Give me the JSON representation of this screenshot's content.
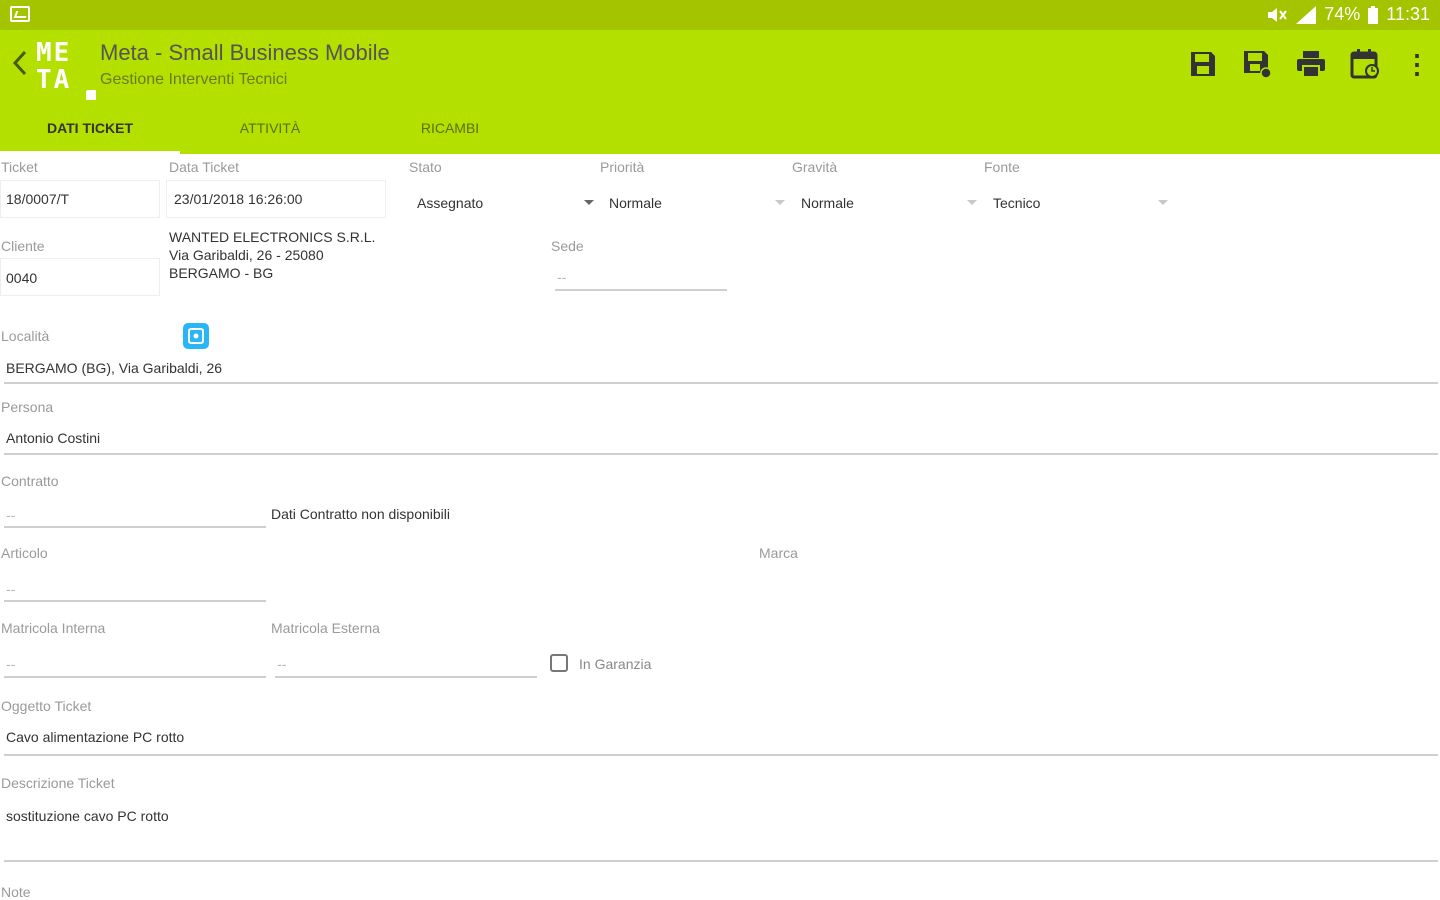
{
  "status_bar": {
    "battery": "74%",
    "time": "11:31"
  },
  "app": {
    "title": "Meta - Small Business Mobile",
    "subtitle": "Gestione Interventi Tecnici",
    "logo_top": "ME",
    "logo_bottom": "TA"
  },
  "toolbar": {
    "icons": [
      "save-icon",
      "save-as-icon",
      "print-icon",
      "calendar-icon",
      "more-icon"
    ],
    "more_label": "⋮"
  },
  "tabs": [
    {
      "label": "DATI TICKET"
    },
    {
      "label": "ATTIVITÀ"
    },
    {
      "label": "RICAMBI"
    }
  ],
  "form": {
    "ticket": {
      "label": "Ticket",
      "value": "18/0007/T"
    },
    "data_ticket": {
      "label": "Data Ticket",
      "value": "23/01/2018 16:26:00"
    },
    "stato": {
      "label": "Stato",
      "value": "Assegnato"
    },
    "priorita": {
      "label": "Priorità",
      "value": "Normale"
    },
    "gravita": {
      "label": "Gravità",
      "value": "Normale"
    },
    "fonte": {
      "label": "Fonte",
      "value": "Tecnico"
    },
    "cliente": {
      "label": "Cliente",
      "value": "0040",
      "name": "WANTED ELECTRONICS S.R.L.",
      "address1": "Via Garibaldi, 26 - 25080",
      "address2": "BERGAMO - BG"
    },
    "sede": {
      "label": "Sede",
      "placeholder": "--"
    },
    "localita": {
      "label": "Località",
      "value": "BERGAMO (BG), Via Garibaldi, 26"
    },
    "persona": {
      "label": "Persona",
      "value": "Antonio Costini"
    },
    "contratto": {
      "label": "Contratto",
      "placeholder": "--",
      "info": "Dati Contratto non disponibili"
    },
    "articolo": {
      "label": "Articolo",
      "placeholder": "--"
    },
    "marca": {
      "label": "Marca"
    },
    "matricola_interna": {
      "label": "Matricola Interna",
      "placeholder": "--"
    },
    "matricola_esterna": {
      "label": "Matricola Esterna",
      "placeholder": "--"
    },
    "in_garanzia": {
      "label": "In Garanzia",
      "checked": false
    },
    "oggetto": {
      "label": "Oggetto Ticket",
      "value": "Cavo alimentazione PC rotto"
    },
    "descrizione": {
      "label": "Descrizione Ticket",
      "value": "sostituzione cavo PC rotto"
    },
    "note": {
      "label": "Note"
    }
  }
}
